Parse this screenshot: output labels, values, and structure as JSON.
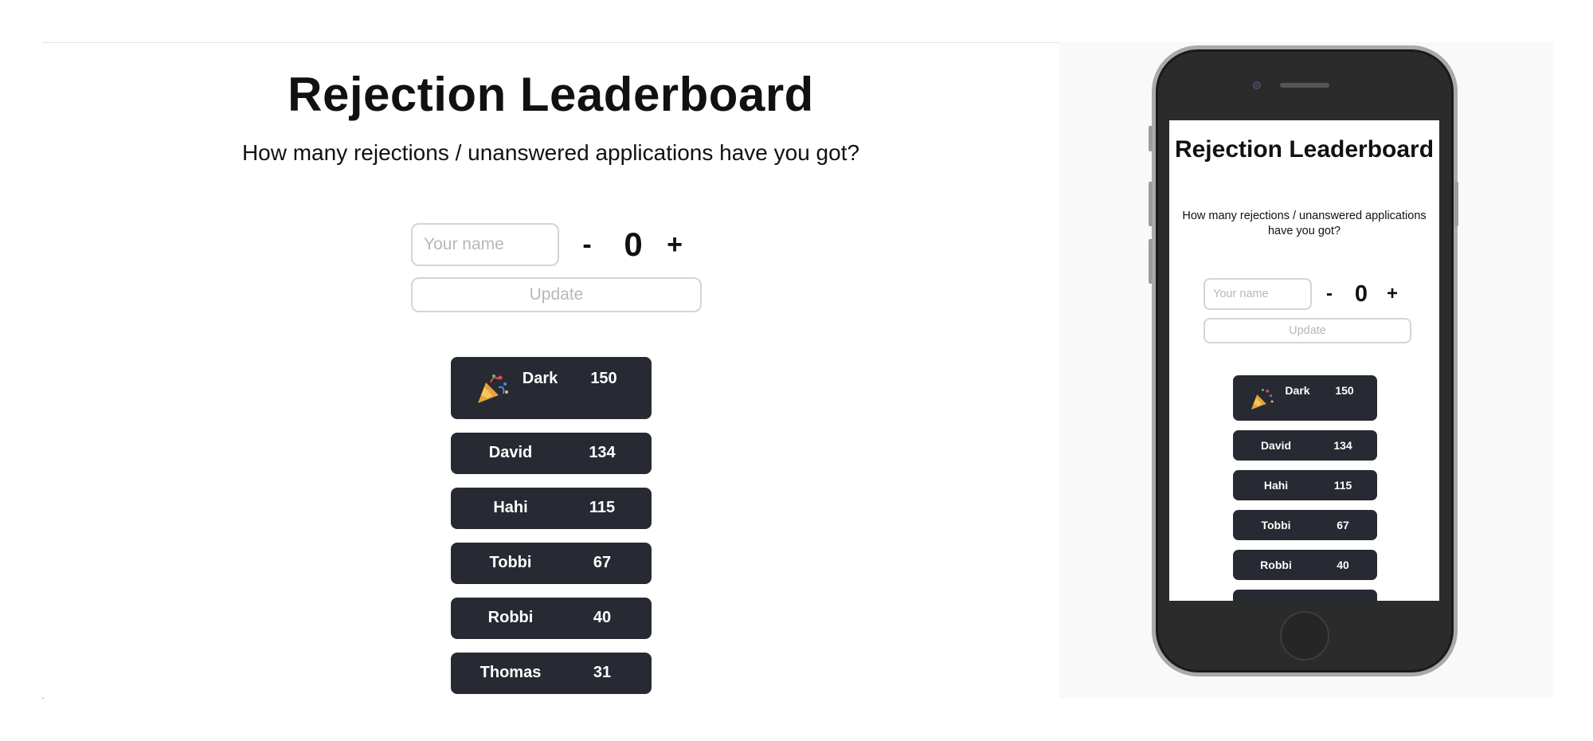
{
  "app": {
    "title": "Rejection Leaderboard",
    "subtitle": "How many rejections / unanswered applications have you got?"
  },
  "form": {
    "name_placeholder": "Your name",
    "decrement_label": "-",
    "count_value": "0",
    "increment_label": "+",
    "update_label": "Update"
  },
  "leaderboard": [
    {
      "name": "Dark",
      "score": "150",
      "icon": "party-popper-icon"
    },
    {
      "name": "David",
      "score": "134"
    },
    {
      "name": "Hahi",
      "score": "115"
    },
    {
      "name": "Tobbi",
      "score": "67"
    },
    {
      "name": "Robbi",
      "score": "40"
    },
    {
      "name": "Thomas",
      "score": "31"
    }
  ],
  "colors": {
    "row_background": "#272a32",
    "row_text": "#ffffff",
    "input_border": "#d4d4d4",
    "placeholder_text": "#b8b8b8",
    "preview_background": "#f9f9f9"
  }
}
